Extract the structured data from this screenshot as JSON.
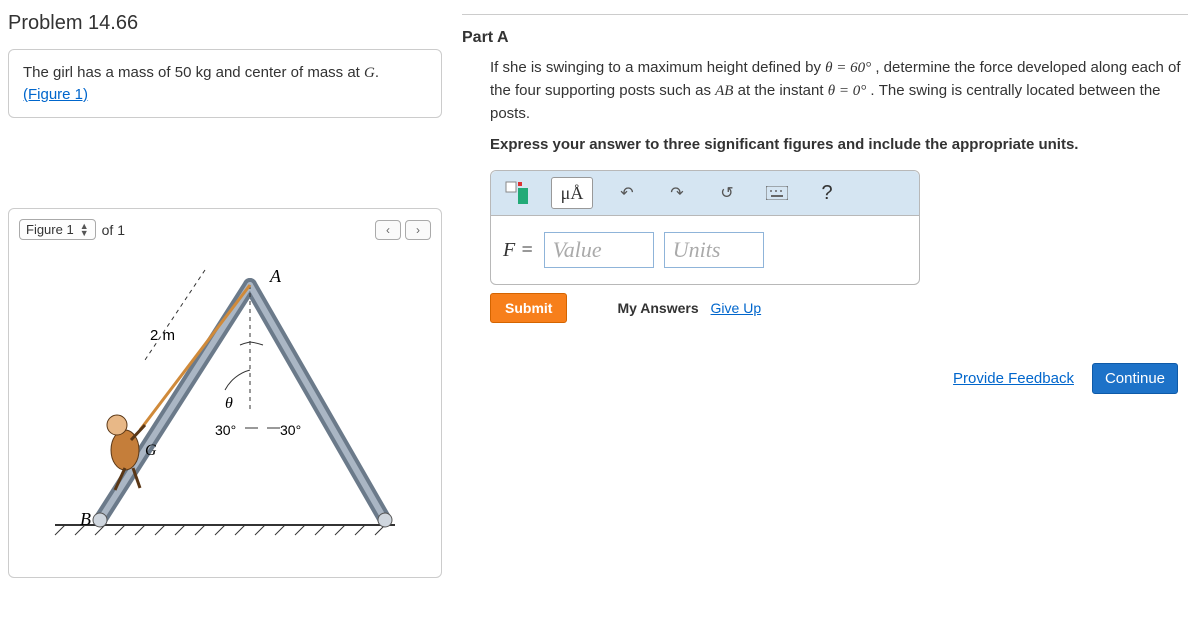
{
  "problem": {
    "title": "Problem 14.66",
    "intro_pre": "The girl has a mass of 50 ",
    "intro_unit": "kg",
    "intro_mid": " and center of mass at ",
    "intro_var": "G",
    "intro_post": ".",
    "figure_link": "(Figure 1)"
  },
  "figure": {
    "selector_label": "Figure 1",
    "of_text": "of 1",
    "labels": {
      "A": "A",
      "B": "B",
      "G": "G",
      "theta": "θ",
      "len": "2 m",
      "ang_left": "30°",
      "ang_right": "30°"
    }
  },
  "partA": {
    "heading": "Part A",
    "q_line1_pre": "If she is swinging to a maximum height defined by ",
    "q_theta1": "θ = 60°",
    "q_line1_mid": " , determine the force developed along each of the four supporting posts such as ",
    "q_AB": "AB",
    "q_line1_mid2": " at the instant ",
    "q_theta2": "θ = 0°",
    "q_line1_end": " . The swing is centrally located between the posts.",
    "q_bold": "Express your answer to three significant figures and include the appropriate units.",
    "eq_label": "F =",
    "value_placeholder": "Value",
    "units_placeholder": "Units",
    "toolbar": {
      "templates": "templates-icon",
      "units_symbol": "μÅ",
      "undo": "undo-icon",
      "redo": "redo-icon",
      "reset": "reset-icon",
      "keyboard": "keyboard-icon",
      "help": "?"
    },
    "submit": "Submit",
    "my_answers": "My Answers",
    "give_up": "Give Up"
  },
  "footer": {
    "provide_feedback": "Provide Feedback",
    "continue": "Continue"
  }
}
